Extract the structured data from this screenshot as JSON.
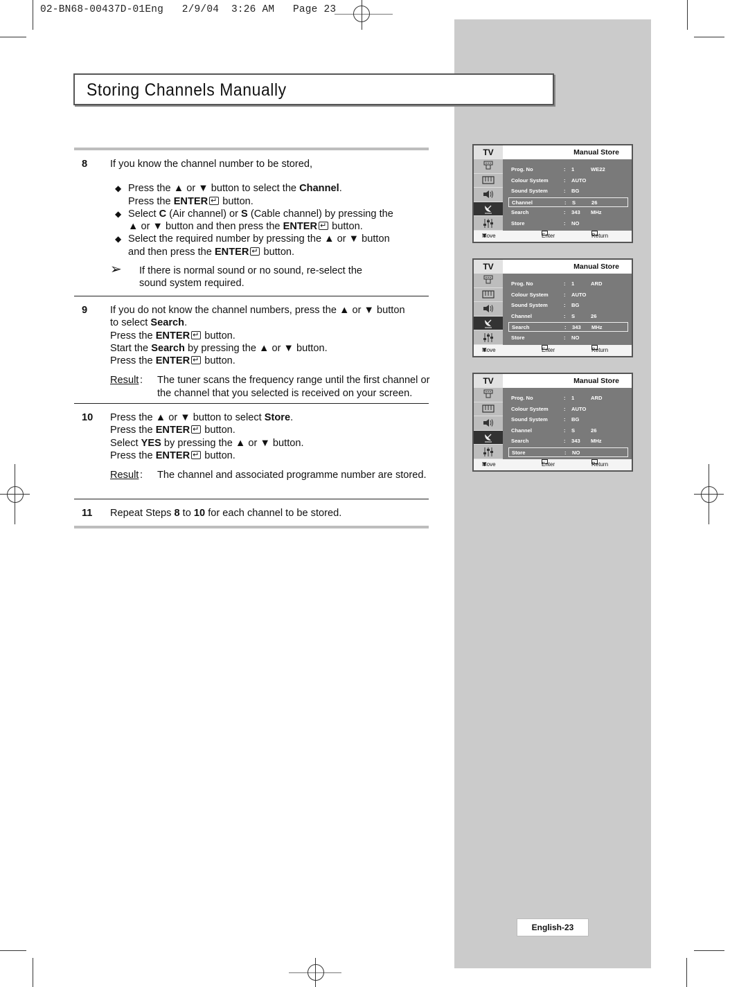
{
  "print_slug": "02-BN68-00437D-01Eng   2/9/04  3:26 AM   Page 23",
  "page_title": "Storing Channels Manually",
  "steps": {
    "s8": {
      "number": "8",
      "intro": "If you know the channel number to be stored,",
      "bullets": [
        {
          "l1_a": "Press the ▲ or ▼ button to select the ",
          "l1_b": "Channel",
          "l1_c": ".",
          "l2_a": "Press the ",
          "l2_b": "ENTER",
          "l2_c": " button."
        },
        {
          "l1_a": "Select ",
          "l1_b": "C",
          "l1_c": " (Air channel) or ",
          "l1_d": "S",
          "l1_e": " (Cable channel) by pressing the",
          "l2_a": "▲ or ▼ button and then press the ",
          "l2_b": "ENTER",
          "l2_c": " button."
        },
        {
          "l1_a": "Select the required number by pressing the ▲ or ▼ button",
          "l2_a": "and then press the ",
          "l2_b": "ENTER",
          "l2_c": " button."
        }
      ],
      "note": "If there is normal sound or no sound, re-select the sound system required."
    },
    "s9": {
      "number": "9",
      "l1": "If you do not know the channel numbers, press the ▲ or ▼ button",
      "l2_a": "to select ",
      "l2_b": "Search",
      "l2_c": ".",
      "l3_a": "Press the ",
      "l3_b": "ENTER",
      "l3_c": " button.",
      "l4_a": "Start the ",
      "l4_b": "Search",
      "l4_c": " by pressing the ▲ or ▼ button.",
      "l5_a": "Press the ",
      "l5_b": "ENTER",
      "l5_c": " button.",
      "result_label": "Result",
      "result_text": "The tuner scans the frequency range until the first channel or the channel that you selected is received on your screen."
    },
    "s10": {
      "number": "10",
      "l1_a": "Press the ▲ or ▼ button to select ",
      "l1_b": "Store",
      "l1_c": ".",
      "l2_a": "Press the ",
      "l2_b": "ENTER",
      "l2_c": " button.",
      "l3_a": "Select ",
      "l3_b": "YES",
      "l3_c": " by pressing the ▲ or ▼ button.",
      "l4_a": "Press the ",
      "l4_b": "ENTER",
      "l4_c": " button.",
      "result_label": "Result",
      "result_text": "The channel and associated programme number are stored."
    },
    "s11": {
      "number": "11",
      "a": "Repeat Steps ",
      "b": "8",
      "c": " to ",
      "d": "10",
      "e": " for each channel to be stored."
    }
  },
  "osd_menus": [
    {
      "tv_label": "TV",
      "title": "Manual Store",
      "selected_row": "Channel",
      "rows": [
        {
          "label": "Prog. No",
          "v1": "1",
          "v2": "WE22"
        },
        {
          "label": "Colour System",
          "v1": "AUTO",
          "v2": ""
        },
        {
          "label": "Sound System",
          "v1": "BG",
          "v2": ""
        },
        {
          "label": "Channel",
          "v1": "S",
          "v2": "26"
        },
        {
          "label": "Search",
          "v1": "343",
          "v2": "MHz"
        },
        {
          "label": "Store",
          "v1": "NO",
          "v2": ""
        }
      ],
      "footer": {
        "move": "Move",
        "enter": "Enter",
        "return": "Return"
      }
    },
    {
      "tv_label": "TV",
      "title": "Manual Store",
      "selected_row": "Search",
      "rows": [
        {
          "label": "Prog. No",
          "v1": "1",
          "v2": "ARD"
        },
        {
          "label": "Colour System",
          "v1": "AUTO",
          "v2": ""
        },
        {
          "label": "Sound System",
          "v1": "BG",
          "v2": ""
        },
        {
          "label": "Channel",
          "v1": "S",
          "v2": "26"
        },
        {
          "label": "Search",
          "v1": "343",
          "v2": "MHz"
        },
        {
          "label": "Store",
          "v1": "NO",
          "v2": ""
        }
      ],
      "footer": {
        "move": "Move",
        "enter": "Enter",
        "return": "Return"
      }
    },
    {
      "tv_label": "TV",
      "title": "Manual Store",
      "selected_row": "Store",
      "rows": [
        {
          "label": "Prog. No",
          "v1": "1",
          "v2": "ARD"
        },
        {
          "label": "Colour System",
          "v1": "AUTO",
          "v2": ""
        },
        {
          "label": "Sound System",
          "v1": "BG",
          "v2": ""
        },
        {
          "label": "Channel",
          "v1": "S",
          "v2": "26"
        },
        {
          "label": "Search",
          "v1": "343",
          "v2": "MHz"
        },
        {
          "label": "Store",
          "v1": "NO",
          "v2": ""
        }
      ],
      "footer": {
        "move": "Move",
        "enter": "Enter",
        "return": "Return"
      }
    }
  ],
  "osd_sidebar_icons": [
    "input-icon",
    "picture-icon",
    "sound-icon",
    "channel-antenna-icon",
    "setup-icon"
  ],
  "osd_active_icon": "channel-antenna-icon",
  "page_label": "English-23",
  "colors": {
    "sidebar_panel": "#cbcbcb",
    "osd_body": "#7a7a7a",
    "osd_active_icon_bg": "#333333"
  }
}
